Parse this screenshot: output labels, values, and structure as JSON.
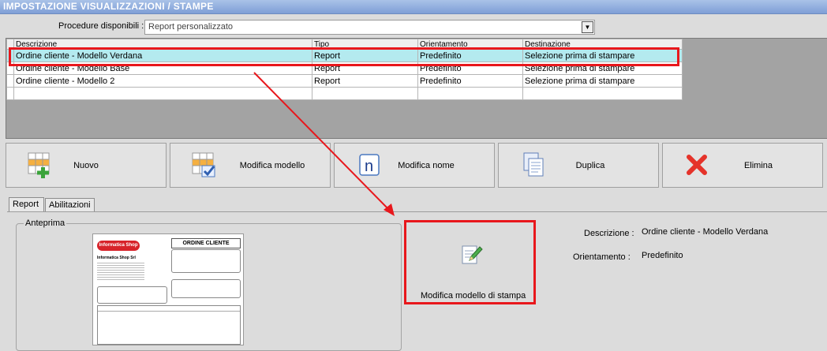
{
  "window": {
    "title": "IMPOSTAZIONE VISUALIZZAZIONI / STAMPE"
  },
  "procedure": {
    "label": "Procedure disponibili :",
    "value": "Report personalizzato"
  },
  "grid": {
    "headers": [
      "Descrizione",
      "Tipo",
      "Orientamento",
      "Destinazione"
    ],
    "rows": [
      {
        "descrizione": "Ordine cliente - Modello Verdana",
        "tipo": "Report",
        "orientamento": "Predefinito",
        "destinazione": "Selezione prima di stampare",
        "selected": true
      },
      {
        "descrizione": "Ordine cliente - Modello Base",
        "tipo": "Report",
        "orientamento": "Predefinito",
        "destinazione": "Selezione prima di stampare",
        "selected": false
      },
      {
        "descrizione": "Ordine cliente - Modello 2",
        "tipo": "Report",
        "orientamento": "Predefinito",
        "destinazione": "Selezione prima di stampare",
        "selected": false
      }
    ]
  },
  "toolbar": {
    "nuovo": "Nuovo",
    "modifica_modello": "Modifica modello",
    "modifica_nome": "Modifica nome",
    "duplica": "Duplica",
    "elimina": "Elimina"
  },
  "tabs": [
    "Report",
    "Abilitazioni"
  ],
  "preview": {
    "label": "Anteprima",
    "logo": "Informatica Shop",
    "company": "Informatica Shop Srl",
    "title": "ORDINE CLIENTE"
  },
  "edit_print": {
    "label": "Modifica modello di stampa"
  },
  "details": {
    "descrizione_label": "Descrizione :",
    "descrizione_value": "Ordine cliente - Modello Verdana",
    "orientamento_label": "Orientamento :",
    "orientamento_value": "Predefinito"
  },
  "colors": {
    "selection": "#b4eaef",
    "highlight": "#e8171c",
    "title_bar": "#7f9fd6"
  },
  "icons": [
    "grid-add-icon",
    "grid-check-icon",
    "rename-n-icon",
    "copy-pages-icon",
    "delete-x-icon",
    "edit-document-icon",
    "dropdown-arrow-icon"
  ]
}
